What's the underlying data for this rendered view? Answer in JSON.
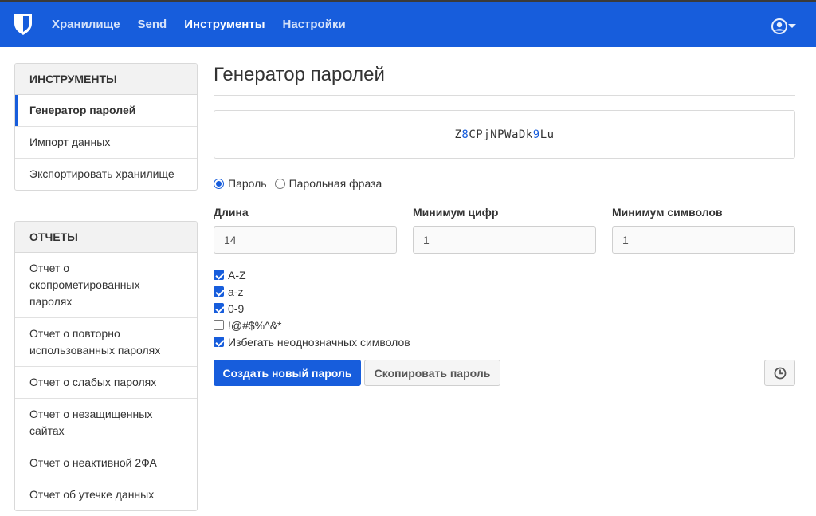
{
  "nav": {
    "brand_icon": "bitwarden-shield-icon",
    "items": [
      {
        "label": "Хранилище",
        "active": false
      },
      {
        "label": "Send",
        "active": false
      },
      {
        "label": "Инструменты",
        "active": true
      },
      {
        "label": "Настройки",
        "active": false
      }
    ],
    "account_icon": "user-circle-icon"
  },
  "sidebar": {
    "tools": {
      "header": "ИНСТРУМЕНТЫ",
      "items": [
        {
          "label": "Генератор паролей",
          "active": true
        },
        {
          "label": "Импорт данных"
        },
        {
          "label": "Экспортировать хранилище"
        }
      ]
    },
    "reports": {
      "header": "ОТЧЕТЫ",
      "items": [
        {
          "label": "Отчет о скопрометированных паролях"
        },
        {
          "label": "Отчет о повторно использованных паролях"
        },
        {
          "label": "Отчет о слабых паролях"
        },
        {
          "label": "Отчет о незащищенных сайтах"
        },
        {
          "label": "Отчет о неактивной 2ФА"
        },
        {
          "label": "Отчет об утечке данных"
        }
      ]
    }
  },
  "main": {
    "title": "Генератор паролей",
    "generated_password": "Z8CPjNPWaDk9Lu",
    "type_options": [
      {
        "label": "Пароль",
        "checked": true
      },
      {
        "label": "Парольная фраза",
        "checked": false
      }
    ],
    "fields": {
      "length": {
        "label": "Длина",
        "value": "14"
      },
      "min_numbers": {
        "label": "Минимум цифр",
        "value": "1"
      },
      "min_special": {
        "label": "Минимум символов",
        "value": "1"
      }
    },
    "options": [
      {
        "label": "A-Z",
        "checked": true
      },
      {
        "label": "a-z",
        "checked": true
      },
      {
        "label": "0-9",
        "checked": true
      },
      {
        "label": "!@#$%^&*",
        "checked": false
      },
      {
        "label": "Избегать неоднозначных символов",
        "checked": true
      }
    ],
    "buttons": {
      "regenerate": "Создать новый пароль",
      "copy": "Скопировать пароль",
      "history_icon": "clock-history-icon"
    }
  },
  "colors": {
    "primary": "#175ddc",
    "number_highlight": "#175ddc"
  }
}
